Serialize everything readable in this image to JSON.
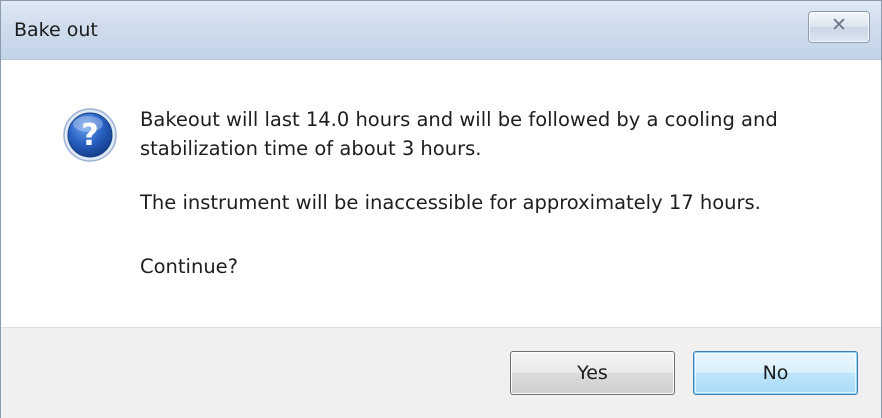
{
  "window": {
    "title": "Bake out",
    "close_glyph": "✕"
  },
  "icon": {
    "name": "question-icon",
    "glyph": "?"
  },
  "message": {
    "line1": "Bakeout will last 14.0 hours and will be followed by a cooling and",
    "line1b": "stabilization time of about 3 hours.",
    "line2": "The instrument will be inaccessible for approximately 17 hours.",
    "line3": "Continue?"
  },
  "buttons": {
    "yes": "Yes",
    "no": "No"
  },
  "colors": {
    "title_bar": "#c3d4e8",
    "footer": "#f0f0f0",
    "icon_blue": "#1f56b4",
    "default_button_border": "#3c7fb1"
  }
}
